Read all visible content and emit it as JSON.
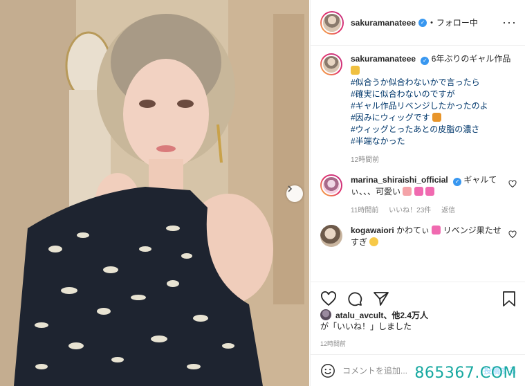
{
  "post": {
    "username": "sakuramanateee",
    "follow_state": "フォロー中",
    "caption_lead": "6年ぶりのギャル作品",
    "hashtags": [
      "#似合うか似合わないかで言ったら",
      "#確実に似合わないのですが",
      "#ギャル作品リベンジしたかったのよ",
      "#因みにウィッグです",
      "#ウィッグとったあとの皮脂の濃さ",
      "#半端なかった"
    ],
    "caption_time": "12時間前"
  },
  "comments": [
    {
      "username": "marina_shiraishi_official",
      "text": "ギャルてぃ、、、可愛い",
      "time": "11時間前",
      "likes": "いいね！23件",
      "reply": "返信"
    },
    {
      "username": "kogawaiori",
      "text_a": "かわてぃ",
      "text_b": "リベンジ果たせすぎ"
    }
  ],
  "likes": {
    "user": "atalu_avcult",
    "others": "、他2.4万人",
    "line2": "が「いいね！」しました"
  },
  "timestamp": "12時間前",
  "add_comment": {
    "placeholder": "コメントを追加..."
  },
  "post_button": "投稿する",
  "watermark": "865367.COM",
  "colors": {
    "link": "#00376b",
    "verified": "#3897f0",
    "muted": "#8e8e8e",
    "watermark": "#16a8a0"
  }
}
